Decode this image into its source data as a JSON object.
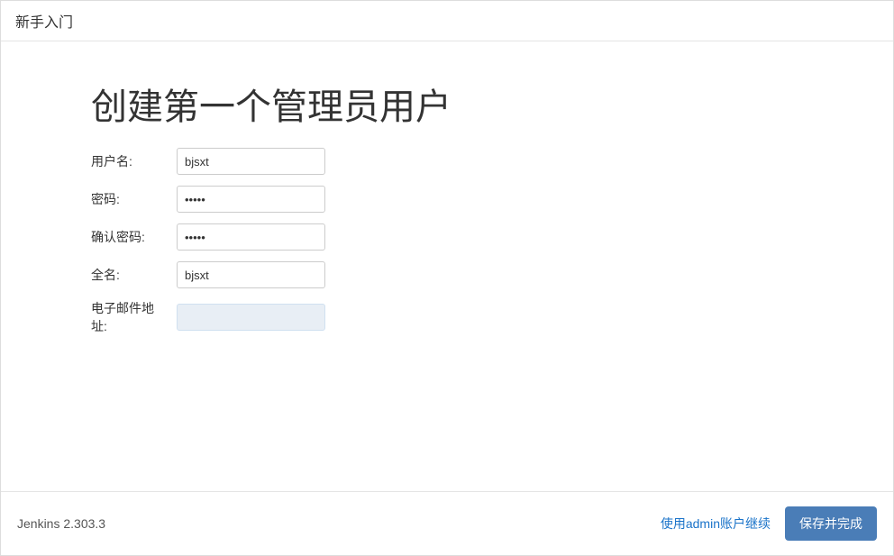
{
  "header": {
    "title": "新手入门"
  },
  "main": {
    "page_title": "创建第一个管理员用户",
    "fields": {
      "username": {
        "label": "用户名:",
        "value": "bjsxt"
      },
      "password": {
        "label": "密码:",
        "value": "•••••"
      },
      "confirm_password": {
        "label": "确认密码:",
        "value": "•••••"
      },
      "fullname": {
        "label": "全名:",
        "value": "bjsxt"
      },
      "email": {
        "label": "电子邮件地址:",
        "value": ""
      }
    }
  },
  "footer": {
    "version": "Jenkins 2.303.3",
    "continue_as_admin": "使用admin账户继续",
    "save_and_finish": "保存并完成"
  }
}
